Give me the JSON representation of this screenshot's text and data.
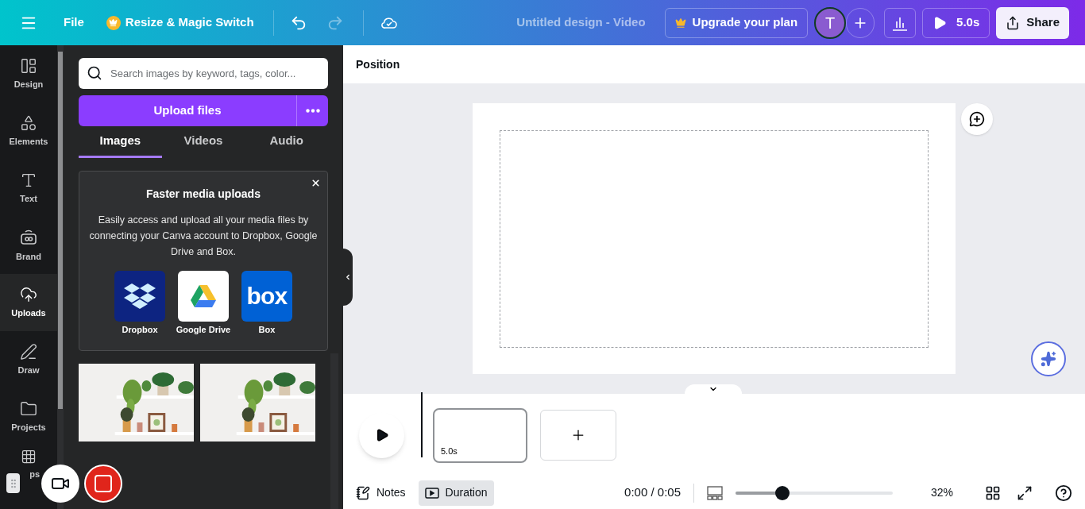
{
  "topbar": {
    "file": "File",
    "resize": "Resize & Magic Switch",
    "title": "Untitled design - Video",
    "upgrade": "Upgrade your plan",
    "avatar": "T",
    "play_time": "5.0s",
    "share": "Share"
  },
  "sidebar": {
    "items": [
      {
        "label": "Design",
        "selected": false
      },
      {
        "label": "Elements",
        "selected": false
      },
      {
        "label": "Text",
        "selected": false
      },
      {
        "label": "Brand",
        "selected": false
      },
      {
        "label": "Uploads",
        "selected": true
      },
      {
        "label": "Draw",
        "selected": false
      },
      {
        "label": "Projects",
        "selected": false
      },
      {
        "label": "ps",
        "selected": false
      }
    ]
  },
  "panel": {
    "search": {
      "placeholder": "Search images by keyword, tags, color..."
    },
    "upload_button": "Upload files",
    "tabs": [
      {
        "label": "Images",
        "selected": true
      },
      {
        "label": "Videos",
        "selected": false
      },
      {
        "label": "Audio",
        "selected": false
      }
    ],
    "promo": {
      "title": "Faster media uploads",
      "body": "Easily access and upload all your media files by connecting your Canva account to Dropbox, Google Drive and Box.",
      "services": [
        {
          "name": "Dropbox",
          "kind": "dropbox"
        },
        {
          "name": "Google Drive",
          "kind": "drive"
        },
        {
          "name": "Box",
          "kind": "box",
          "logo": "box"
        }
      ]
    }
  },
  "editor": {
    "toolbar_label": "Position"
  },
  "timeline": {
    "clips": [
      {
        "duration": "5.0s",
        "selected": true
      }
    ]
  },
  "footer": {
    "notes": "Notes",
    "duration": {
      "label": "Duration",
      "selected": true
    },
    "time": "0:00 / 0:05",
    "zoom": {
      "level": 0.3,
      "reading": "32%"
    }
  }
}
